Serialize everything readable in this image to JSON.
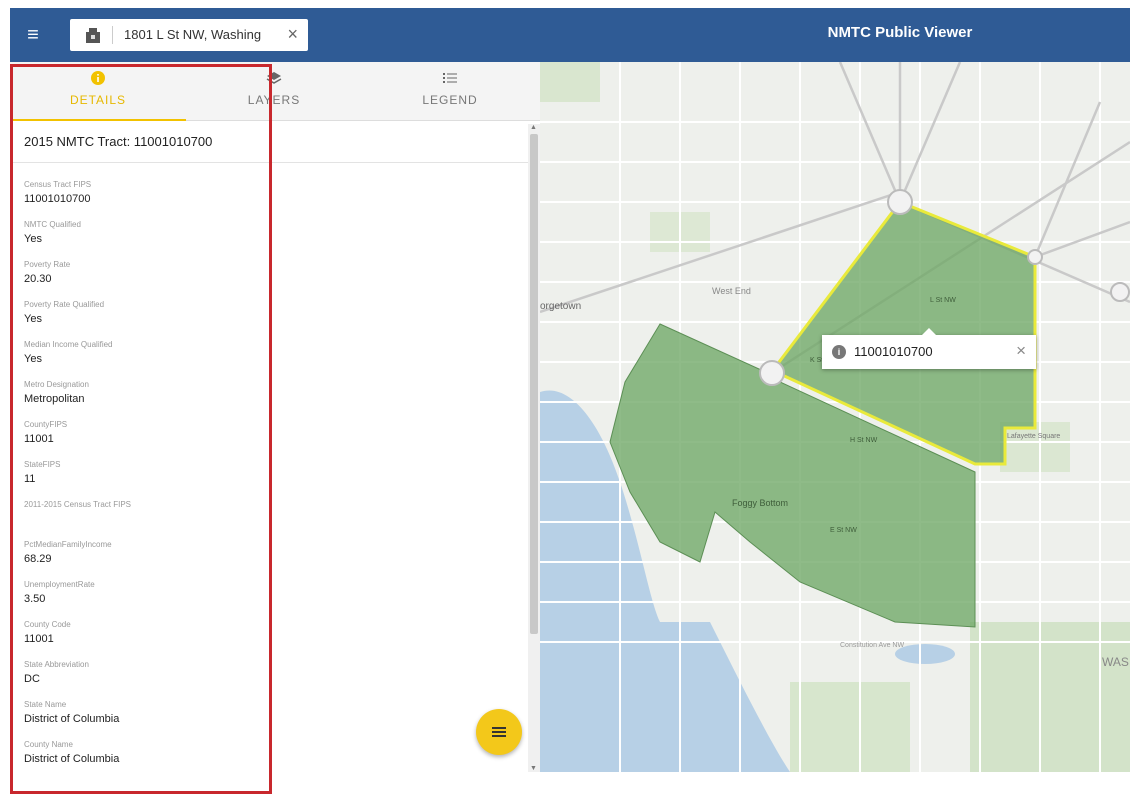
{
  "header": {
    "menu_icon": "hamburger-menu-icon",
    "search_value": "1801 L St NW, Washing",
    "search_clear": "×",
    "title": "NMTC Public Viewer"
  },
  "tabs": [
    {
      "label": "DETAILS",
      "icon": "info-icon",
      "active": true
    },
    {
      "label": "LAYERS",
      "icon": "layers-icon",
      "active": false
    },
    {
      "label": "LEGEND",
      "icon": "legend-list-icon",
      "active": false
    }
  ],
  "details": {
    "title": "2015 NMTC Tract: 11001010700",
    "fields": [
      {
        "key": "Census Tract FIPS",
        "value": "11001010700"
      },
      {
        "key": "NMTC Qualified",
        "value": "Yes"
      },
      {
        "key": "Poverty Rate",
        "value": "20.30"
      },
      {
        "key": "Poverty Rate Qualified",
        "value": "Yes"
      },
      {
        "key": "Median Income Qualified",
        "value": "Yes"
      },
      {
        "key": "Metro Designation",
        "value": "Metropolitan"
      },
      {
        "key": "CountyFIPS",
        "value": "11001"
      },
      {
        "key": "StateFIPS",
        "value": "11"
      },
      {
        "key": "2011-2015 Census Tract FIPS",
        "value": ""
      },
      {
        "key": "PctMedianFamilyIncome",
        "value": "68.29"
      },
      {
        "key": "UnemploymentRate",
        "value": "3.50"
      },
      {
        "key": "County Code",
        "value": "11001"
      },
      {
        "key": "State Abbreviation",
        "value": "DC"
      },
      {
        "key": "State Name",
        "value": "District of Columbia"
      },
      {
        "key": "County Name",
        "value": "District of Columbia"
      }
    ]
  },
  "fab_icon": "list-menu-icon",
  "map": {
    "popup_text": "11001010700",
    "popup_close": "×",
    "labels": {
      "georgetown": "orgetown",
      "west_end": "West End",
      "foggy_bottom": "Foggy Bottom",
      "was": "WAS",
      "lafayette": "Lafayette Square",
      "constitution": "Constitution Ave NW",
      "l_st": "L St NW",
      "k_st": "K St NW",
      "h_st": "H St NW",
      "e_st": "E St NW"
    }
  },
  "colors": {
    "header_bg": "#2f5b95",
    "tab_active": "#f2c200",
    "tract_fill": "#6fa867",
    "tract_selected_outline": "#e9ea3b",
    "highlight_box": "#c8282d",
    "water": "#b7d0e6"
  }
}
